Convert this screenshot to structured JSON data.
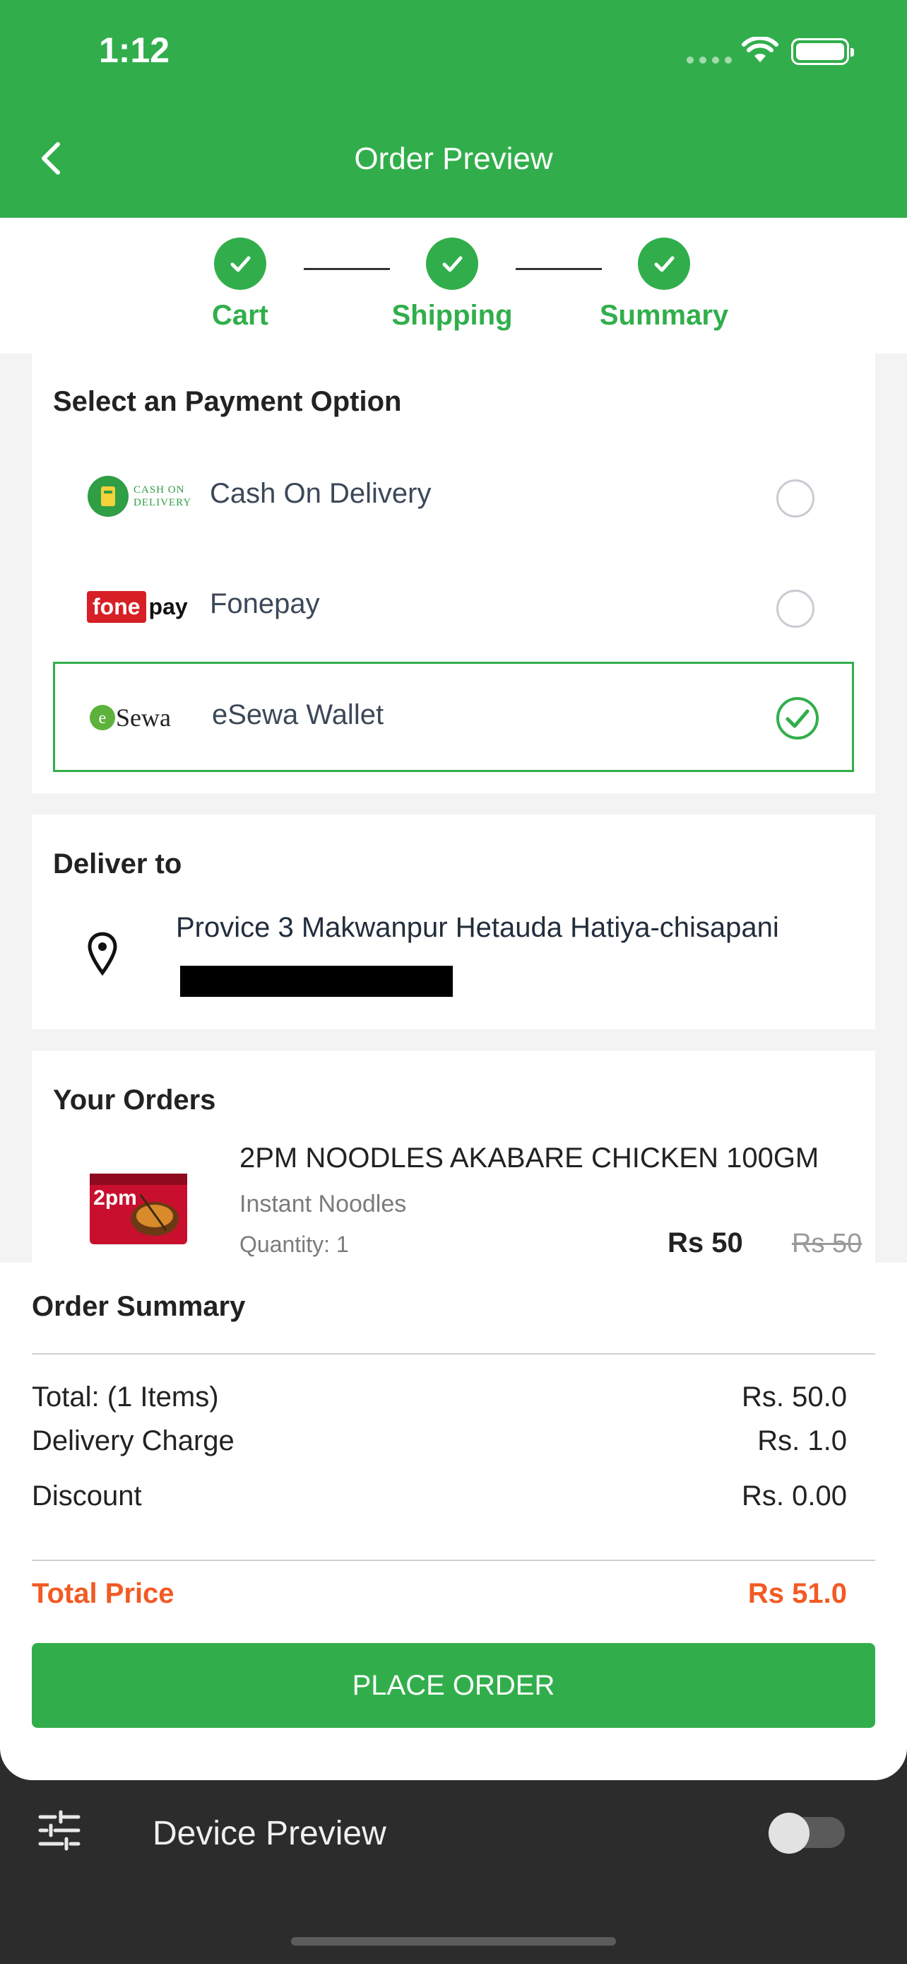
{
  "status_bar": {
    "time": "1:12"
  },
  "header": {
    "title": "Order Preview",
    "back_icon": "chevron-left-icon"
  },
  "stepper": {
    "steps": [
      {
        "label": "Cart",
        "done": true
      },
      {
        "label": "Shipping",
        "done": true
      },
      {
        "label": "Summary",
        "done": true
      }
    ]
  },
  "payment": {
    "title": "Select an Payment Option",
    "options": [
      {
        "label": "Cash On Delivery",
        "logo_text": "CASH ON DELIVERY",
        "selected": false
      },
      {
        "label": "Fonepay",
        "logo_text": "fonepay",
        "selected": false
      },
      {
        "label": "eSewa Wallet",
        "logo_text": "eSewa",
        "selected": true
      }
    ]
  },
  "delivery": {
    "title": "Deliver to",
    "address": "Provice 3 Makwanpur Hetauda Hatiya-chisapani",
    "icon": "location-pin-icon"
  },
  "orders": {
    "title": "Your Orders",
    "items": [
      {
        "name": "2PM NOODLES AKABARE CHICKEN 100GM",
        "category": "Instant Noodles",
        "quantity": "Quantity: 1",
        "price": "Rs 50",
        "original_price": "Rs 50",
        "image_text": "2pm"
      }
    ]
  },
  "summary": {
    "title": "Order Summary",
    "rows": [
      {
        "label": "Total: (1 Items)",
        "value": "Rs. 50.0"
      },
      {
        "label": "Delivery Charge",
        "value": "Rs. 1.0"
      },
      {
        "label": "Discount",
        "value": "Rs. 0.00"
      }
    ],
    "total_label": "Total Price",
    "total_value": "Rs 51.0",
    "button": "PLACE ORDER"
  },
  "device_preview": {
    "label": "Device Preview",
    "icon": "tune-sliders-icon",
    "enabled": false
  },
  "colors": {
    "primary": "#31ae4b",
    "accent": "#f25a24",
    "dark": "#2c2c2c"
  }
}
